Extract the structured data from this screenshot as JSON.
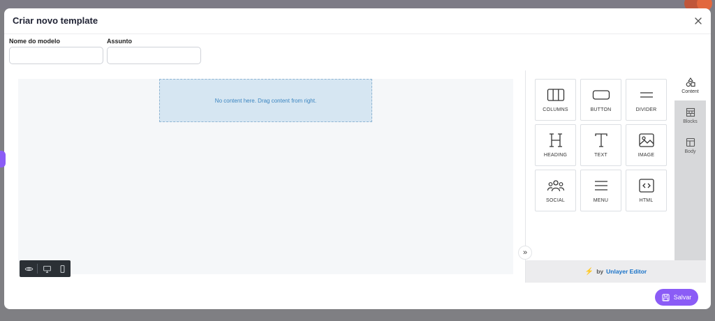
{
  "modal": {
    "title": "Criar novo template"
  },
  "form": {
    "name_label": "Nome do modelo",
    "name_value": "",
    "subject_label": "Assunto",
    "subject_value": ""
  },
  "canvas": {
    "empty_message": "No content here. Drag content from right."
  },
  "view_toolbar": {
    "icons": [
      "eye-icon",
      "desktop-icon",
      "mobile-icon"
    ]
  },
  "tools": [
    {
      "label": "COLUMNS",
      "icon": "columns-icon"
    },
    {
      "label": "BUTTON",
      "icon": "button-icon"
    },
    {
      "label": "DIVIDER",
      "icon": "divider-icon"
    },
    {
      "label": "HEADING",
      "icon": "heading-icon"
    },
    {
      "label": "TEXT",
      "icon": "text-icon"
    },
    {
      "label": "IMAGE",
      "icon": "image-icon"
    },
    {
      "label": "SOCIAL",
      "icon": "social-icon"
    },
    {
      "label": "MENU",
      "icon": "menu-icon"
    },
    {
      "label": "HTML",
      "icon": "html-icon"
    }
  ],
  "tabs": [
    {
      "label": "Content",
      "icon": "shapes-icon",
      "active": true
    },
    {
      "label": "Blocks",
      "icon": "blocks-icon",
      "active": false
    },
    {
      "label": "Body",
      "icon": "body-layout-icon",
      "active": false
    }
  ],
  "footer": {
    "by": "by",
    "brand": "Unlayer Editor"
  },
  "actions": {
    "save_label": "Salvar"
  },
  "colors": {
    "accent": "#8b5cf6",
    "dropzone_bg": "#d6e6f2",
    "dropzone_text": "#3a84c0",
    "brand_link": "#1a73c8"
  }
}
